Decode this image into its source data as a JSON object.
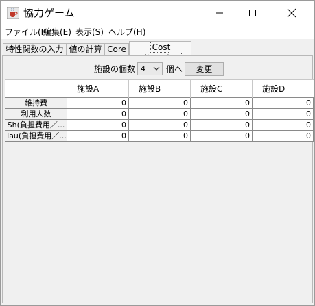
{
  "window": {
    "title": "協力ゲーム"
  },
  "menu": [
    "ファイル(F)",
    "編集(E)",
    "表示(S)",
    "ヘルプ(H)"
  ],
  "tabs": [
    "特性関数の入力",
    "値の計算",
    "Core",
    "Cost Allocation"
  ],
  "active_tab": "Cost Allocation",
  "controls": {
    "facility_count_label": "施設の個数",
    "facility_count_value": "4",
    "unit_label": "個へ",
    "change_button": "変更"
  },
  "table": {
    "columns": [
      "",
      "施設A",
      "施設B",
      "施設C",
      "施設D"
    ],
    "rows": [
      {
        "label": "維持費",
        "values": [
          "0",
          "0",
          "0",
          "0"
        ]
      },
      {
        "label": "利用人数",
        "values": [
          "0",
          "0",
          "0",
          "0"
        ]
      },
      {
        "label": "Sh(負担費用／...",
        "values": [
          "0",
          "0",
          "0",
          "0"
        ]
      },
      {
        "label": "Tau(負担費用／...",
        "values": [
          "0",
          "0",
          "0",
          "0"
        ]
      }
    ]
  }
}
